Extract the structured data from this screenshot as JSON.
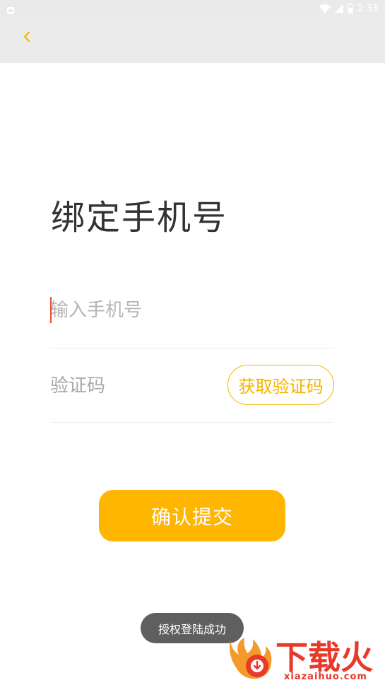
{
  "status_bar": {
    "time": "2:33"
  },
  "app_bar": {
    "back_icon": "chevron-left-icon"
  },
  "page": {
    "title": "绑定手机号"
  },
  "form": {
    "phone_placeholder": "输入手机号",
    "code_placeholder": "验证码",
    "get_code_label": "获取验证码",
    "submit_label": "确认提交"
  },
  "toast": {
    "message": "授权登陆成功"
  },
  "watermark": {
    "brand": "下载火",
    "domain": "xiazaihuo.com"
  },
  "colors": {
    "accent": "#ffb600",
    "accent_text": "#f5b400",
    "caret": "#e8502f",
    "watermark": "#e8392b"
  }
}
